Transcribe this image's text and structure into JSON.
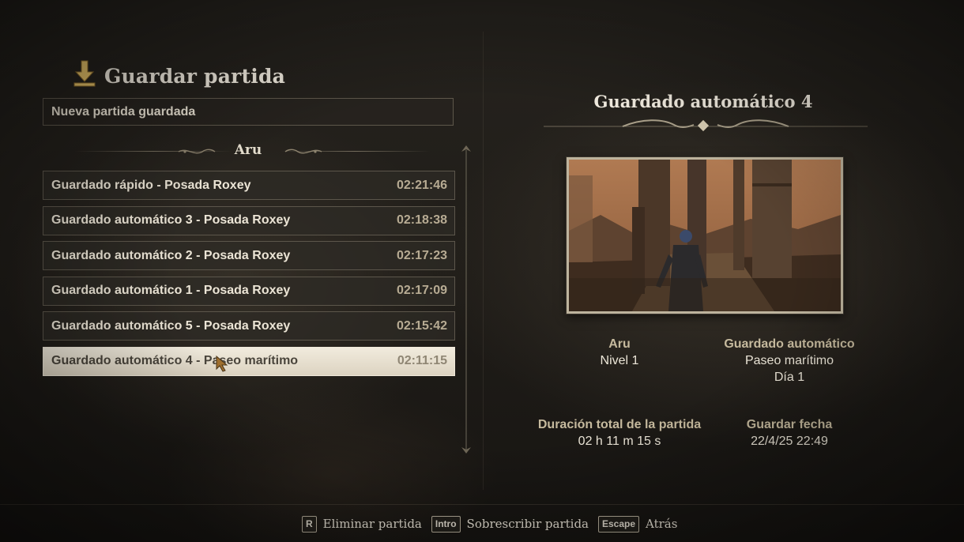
{
  "header": {
    "title": "Guardar partida",
    "icon": "save-download-icon"
  },
  "new_save_label": "Nueva partida guardada",
  "section_label": "Aru",
  "saves": [
    {
      "name": "Guardado rápido - Posada Roxey",
      "time": "02:21:46"
    },
    {
      "name": "Guardado automático 3 - Posada Roxey",
      "time": "02:18:38"
    },
    {
      "name": "Guardado automático 2 - Posada Roxey",
      "time": "02:17:23"
    },
    {
      "name": "Guardado automático 1 - Posada Roxey",
      "time": "02:17:09"
    },
    {
      "name": "Guardado automático 5 - Posada Roxey",
      "time": "02:15:42"
    },
    {
      "name": "Guardado automático 4 - Paseo marítimo",
      "time": "02:11:15",
      "selected": true
    }
  ],
  "detail": {
    "title": "Guardado automático 4",
    "character": {
      "name": "Aru",
      "level": "Nivel 1"
    },
    "save_type": {
      "label": "Guardado automático",
      "location": "Paseo marítimo",
      "day": "Día 1"
    },
    "playtime": {
      "label": "Duración total de la partida",
      "value": "02 h 11 m 15 s"
    },
    "save_date": {
      "label": "Guardar fecha",
      "value": "22/4/25 22:49"
    }
  },
  "footer": [
    {
      "key": "R",
      "label": "Eliminar partida"
    },
    {
      "key": "Intro",
      "label": "Sobrescribir partida"
    },
    {
      "key": "Escape",
      "label": "Atrás"
    }
  ],
  "colors": {
    "accent": "#c6ba9e",
    "selected_bg": "#f1ebdd",
    "text": "#ece5d6"
  }
}
